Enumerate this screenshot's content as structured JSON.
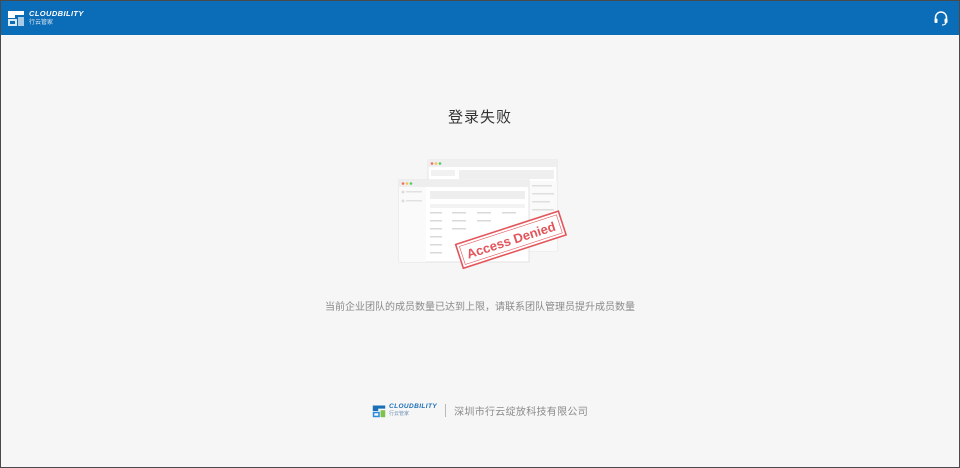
{
  "header": {
    "brand_en": "CLOUDBILITY",
    "brand_cn": "行云管家",
    "support_icon": "headset-icon",
    "colors": {
      "bar": "#0b6cb7"
    }
  },
  "main": {
    "title": "登录失败",
    "stamp_text": "Access Denied",
    "message": "当前企业团队的成员数量已达到上限，请联系团队管理员提升成员数量",
    "colors": {
      "stamp": "#e2555a"
    }
  },
  "footer": {
    "brand_en": "CLOUDBILITY",
    "brand_cn": "行云管家",
    "company": "深圳市行云绽放科技有限公司"
  }
}
